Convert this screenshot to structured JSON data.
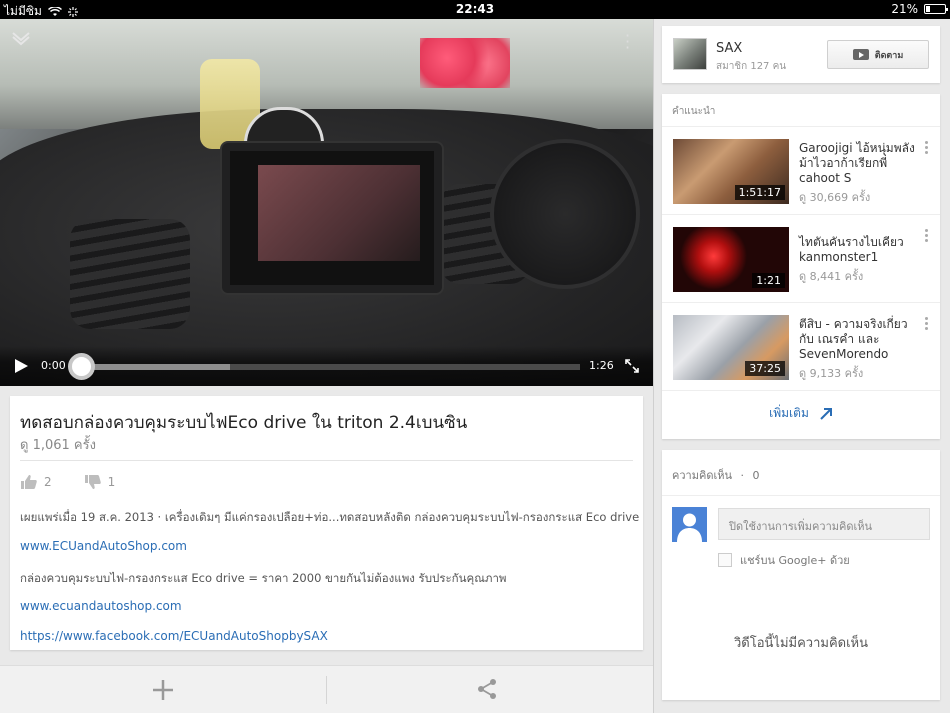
{
  "status": {
    "carrier": "ไม่มีซิม",
    "time": "22:43",
    "battery": "21%"
  },
  "video": {
    "time_current": "0:00",
    "time_total": "1:26",
    "progress_loaded_pct": 30
  },
  "info": {
    "title": "ทดสอบกล่องควบคุมระบบไฟEco drive ใน triton 2.4เบนซิน",
    "views": "ดู 1,061 ครั้ง",
    "likes": "2",
    "dislikes": "1",
    "published": "เผยแพร่เมื่อ 19 ส.ค. 2013 · เครื่องเดิมๆ มีแค่กรองเปลือย+ท่อ...ทดสอบหลังติด กล่องควบคุมระบบไฟ-กรองกระแส Eco drive",
    "link1": "www.ECUandAutoShop.com",
    "desc2": "กล่องควบคุมระบบไฟ-กรองกระแส Eco drive = ราคา 2000 ขายกันไม่ต้องแพง รับประกันคุณภาพ",
    "link2": "www.ecuandautoshop.com",
    "link3": "https://www.facebook.com/ECUandAutoShopbySAX"
  },
  "channel": {
    "name": "SAX",
    "subscribers": "สมาชิก 127 คน",
    "subscribe_label": "ติดตาม"
  },
  "recommendations": {
    "header": "คำแนะนำ",
    "items": [
      {
        "title": "Garoojigi ไอ้หนุ่มพลังม้าไวอาก้าเรียกพี่ cahoot S",
        "views": "ดู 30,669 ครั้ง",
        "duration": "1:51:17"
      },
      {
        "title": "ไทตันคันรางไบเคียว kanmonster1",
        "views": "ดู 8,441 ครั้ง",
        "duration": "1:21"
      },
      {
        "title": "ตีสิบ - ความจริงเกี่ยวกับ เณรคำ และ SevenMorendo",
        "views": "ดู 9,133 ครั้ง",
        "duration": "37:25"
      }
    ],
    "more_label": "เพิ่มเติม"
  },
  "comments": {
    "header": "ความคิดเห็น",
    "count": "0",
    "input_placeholder": "ปิดใช้งานการเพิ่มความคิดเห็น",
    "gplus_label": "แชร์บน Google+ ด้วย",
    "empty_text": "วิดีโอนี้ไม่มีความคิดเห็น"
  },
  "colors": {
    "link": "#2a6db5",
    "avatar": "#4a82d6"
  }
}
